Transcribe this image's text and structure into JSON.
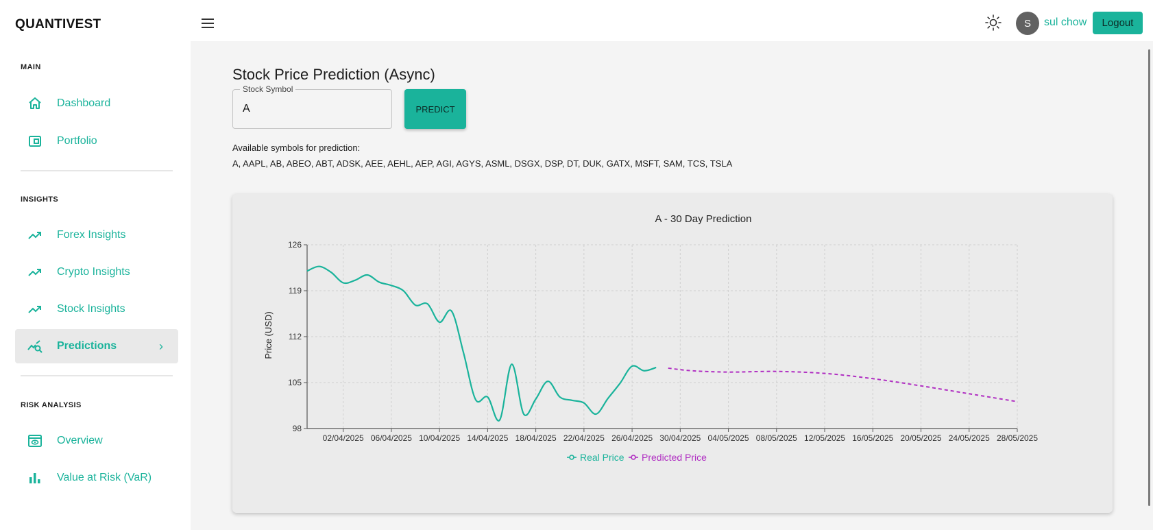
{
  "app": {
    "brand": "QUANTIVEST"
  },
  "header": {
    "user_initial": "S",
    "username": "sul chow",
    "logout_label": "Logout"
  },
  "sidebar": {
    "sections": [
      {
        "label": "MAIN",
        "items": [
          {
            "label": "Dashboard",
            "icon": "home-icon"
          },
          {
            "label": "Portfolio",
            "icon": "wallet-icon"
          }
        ]
      },
      {
        "label": "INSIGHTS",
        "items": [
          {
            "label": "Forex Insights",
            "icon": "trending-up-icon"
          },
          {
            "label": "Crypto Insights",
            "icon": "trending-up-icon"
          },
          {
            "label": "Stock Insights",
            "icon": "trending-up-icon"
          },
          {
            "label": "Predictions",
            "icon": "query-stats-icon",
            "active": true
          }
        ]
      },
      {
        "label": "RISK ANALYSIS",
        "items": [
          {
            "label": "Overview",
            "icon": "preview-icon"
          },
          {
            "label": "Value at Risk (VaR)",
            "icon": "bar-chart-icon"
          }
        ]
      }
    ]
  },
  "main": {
    "title": "Stock Price Prediction (Async)",
    "symbol_field": {
      "label": "Stock Symbol",
      "value": "A"
    },
    "predict_label": "PREDICT",
    "available_label": "Available symbols for prediction:",
    "available_symbols": "A, AAPL, AB, ABEO, ABT, ADSK, AEE, AEHL, AEP, AGI, AGYS, ASML, DSGX, DSP, DT, DUK, GATX, MSFT, SAM, TCS, TSLA"
  },
  "colors": {
    "accent": "#1ab39b",
    "predicted": "#b02ec2",
    "background": "#f4f4f4"
  },
  "chart_data": {
    "type": "line",
    "title": "A - 30 Day Prediction",
    "xlabel": "",
    "ylabel": "Price (USD)",
    "ylim": [
      98,
      126
    ],
    "yticks": [
      98,
      105,
      112,
      119,
      126
    ],
    "xlim": [
      "2025-03-30",
      "2025-05-28"
    ],
    "xtick_labels": [
      "02/04/2025",
      "06/04/2025",
      "10/04/2025",
      "14/04/2025",
      "18/04/2025",
      "22/04/2025",
      "26/04/2025",
      "30/04/2025",
      "04/05/2025",
      "08/05/2025",
      "12/05/2025",
      "16/05/2025",
      "20/05/2025",
      "24/05/2025",
      "28/05/2025"
    ],
    "grid": true,
    "legend_position": "bottom",
    "series": [
      {
        "name": "Real Price",
        "style": "solid",
        "color": "#1ab39b",
        "points": [
          [
            "2025-03-30",
            122.0
          ],
          [
            "2025-03-31",
            122.7
          ],
          [
            "2025-04-01",
            121.8
          ],
          [
            "2025-04-02",
            120.2
          ],
          [
            "2025-04-03",
            120.6
          ],
          [
            "2025-04-04",
            121.4
          ],
          [
            "2025-04-05",
            120.3
          ],
          [
            "2025-04-06",
            119.8
          ],
          [
            "2025-04-07",
            119.0
          ],
          [
            "2025-04-08",
            116.8
          ],
          [
            "2025-04-09",
            117.0
          ],
          [
            "2025-04-10",
            114.2
          ],
          [
            "2025-04-11",
            115.9
          ],
          [
            "2025-04-12",
            109.5
          ],
          [
            "2025-04-13",
            102.4
          ],
          [
            "2025-04-14",
            102.8
          ],
          [
            "2025-04-15",
            99.3
          ],
          [
            "2025-04-16",
            107.8
          ],
          [
            "2025-04-17",
            100.2
          ],
          [
            "2025-04-18",
            102.5
          ],
          [
            "2025-04-19",
            105.2
          ],
          [
            "2025-04-20",
            102.8
          ],
          [
            "2025-04-21",
            102.3
          ],
          [
            "2025-04-22",
            101.9
          ],
          [
            "2025-04-23",
            100.2
          ],
          [
            "2025-04-24",
            102.6
          ],
          [
            "2025-04-25",
            104.9
          ],
          [
            "2025-04-26",
            107.5
          ],
          [
            "2025-04-27",
            106.8
          ],
          [
            "2025-04-28",
            107.3
          ]
        ]
      },
      {
        "name": "Predicted Price",
        "style": "dashed",
        "color": "#b02ec2",
        "points": [
          [
            "2025-04-29",
            107.2
          ],
          [
            "2025-05-01",
            106.8
          ],
          [
            "2025-05-04",
            106.6
          ],
          [
            "2025-05-08",
            106.7
          ],
          [
            "2025-05-12",
            106.4
          ],
          [
            "2025-05-16",
            105.6
          ],
          [
            "2025-05-20",
            104.5
          ],
          [
            "2025-05-24",
            103.3
          ],
          [
            "2025-05-28",
            102.1
          ]
        ]
      }
    ]
  }
}
